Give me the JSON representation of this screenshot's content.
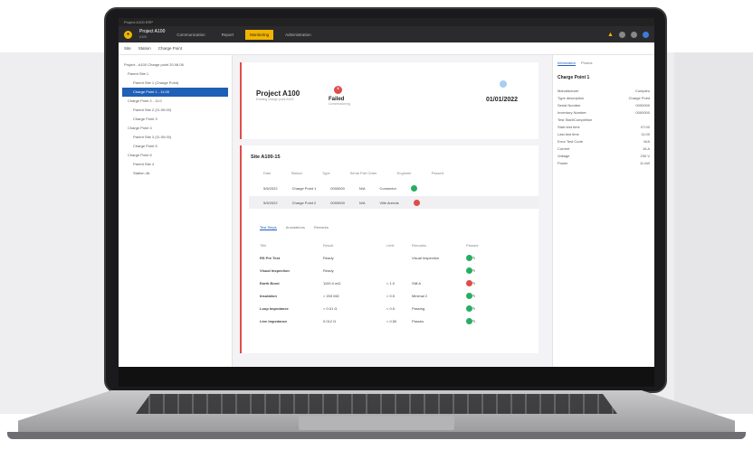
{
  "app": {
    "title_text": "Project A100 ERP",
    "project_name": "Project A100",
    "project_sub": "A100"
  },
  "nav": {
    "tabs": [
      "Communication",
      "Report",
      "Monitoring",
      "Administration"
    ],
    "active_index": 2
  },
  "toolbar": {
    "items": [
      "Site",
      "Station",
      "Charge Point"
    ]
  },
  "tree": {
    "items": [
      "Project - A100 Charge point 20.08.06",
      "Parent Site 1",
      "Parent Site 1 (Charge Point)",
      "Charge Point 1 - 11:00",
      "Charge Point 2 - 11:0",
      "Parent Site 2 (11:00:00)",
      "Charge Point 3",
      "Charge Point 4",
      "Parent Site 3 (11:00:00)",
      "Charge Point 5",
      "Charge Point 6",
      "Parent Site 4",
      "Station 4A"
    ],
    "selected_index": 3
  },
  "summary": {
    "project_title": "Project A100",
    "project_sub": "Existing charge point A100",
    "status_label": "Failed",
    "status_sub": "Commissioning",
    "date": "01/01/2022"
  },
  "site": {
    "title": "Site A100-15",
    "columns": [
      "Date",
      "Station",
      "Type",
      "Serial Part Order",
      "Engineer",
      "Passed"
    ],
    "rows": [
      {
        "date": "5/5/2022",
        "station": "Charge Point 1",
        "type": "0000000",
        "order": "N/A",
        "engineer": "Connector",
        "status": "ok"
      },
      {
        "date": "5/5/2022",
        "station": "Charge Point 2",
        "type": "0000000",
        "order": "N/A",
        "engineer": "Ville Arends",
        "status": "bad"
      }
    ]
  },
  "subtabs": {
    "labels": [
      "Test Steps",
      "Annotations",
      "Remarks"
    ],
    "active_index": 0
  },
  "steps": {
    "columns": [
      "Title",
      "Result",
      "Limit",
      "Remarks",
      "Passed"
    ],
    "rows": [
      {
        "title": "RS Pre Test",
        "result": "Ready",
        "limit": "",
        "remark": "Visual Inspection",
        "status": "ok"
      },
      {
        "title": "Visual Inspection",
        "result": "Ready",
        "limit": "",
        "remark": "",
        "status": "ok"
      },
      {
        "title": "Earth Bond",
        "result": "1100.0 mΩ",
        "limit": "< 1.0",
        "remark": "Still A",
        "status": "bad"
      },
      {
        "title": "Insulation",
        "result": "> 200 MΩ",
        "limit": "> 0.5",
        "remark": "Minimal 2",
        "status": "ok"
      },
      {
        "title": "Loop Impedance",
        "result": "< 0.01 Ω",
        "limit": "< 0.5",
        "remark": "Passing",
        "status": "ok"
      },
      {
        "title": "Line Impedance",
        "result": "0.012 Ω",
        "limit": "< 0.50",
        "remark": "Passes",
        "status": "ok"
      }
    ]
  },
  "side": {
    "tabs": [
      "Information",
      "Photos"
    ],
    "title": "Charge Point 1",
    "fields": [
      [
        "Manufacturer",
        "Compleo"
      ],
      [
        "Type description",
        "Charge Point"
      ],
      [
        "Serial Number",
        "0000000"
      ],
      [
        "Inventory Number",
        "0000000"
      ],
      [
        "Test Start/Completion",
        ""
      ],
      [
        "Start test time",
        "07:00"
      ],
      [
        "Last test time",
        "11:00"
      ],
      [
        "Error Test Code",
        "N/A"
      ],
      [
        "Current",
        "16 A"
      ],
      [
        "Voltage",
        "230 V"
      ],
      [
        "Power",
        "11 kW"
      ]
    ]
  },
  "colors": {
    "accent": "#f2b400",
    "selected": "#1f5fb6",
    "ok": "#27ae60",
    "bad": "#e14b4b"
  }
}
